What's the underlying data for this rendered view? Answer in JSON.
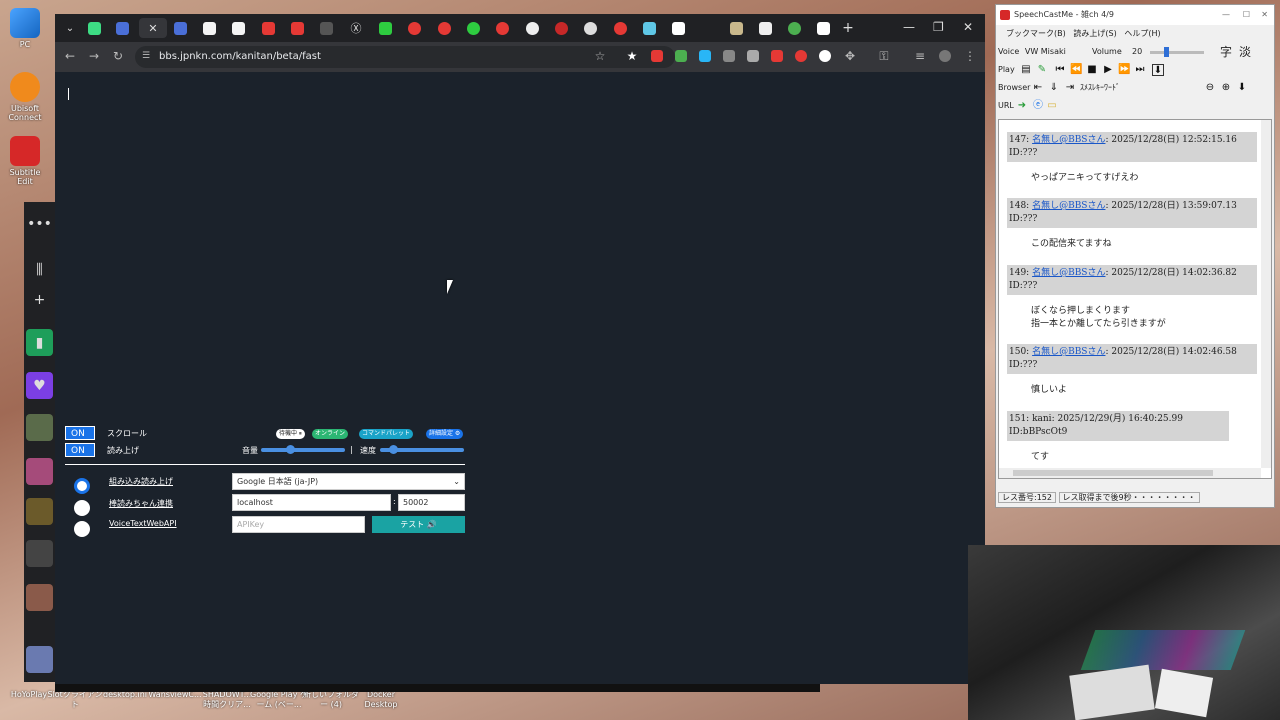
{
  "desktop_icons": [
    "PC",
    "Ubisoft Connect",
    "Subtitle Edit"
  ],
  "taskbar_icons": [
    "HoYoPlay",
    "Slotクライアント",
    "desktop.ini",
    "WansviewC...",
    "SHADOWT... 時間クリア...",
    "Google Play ゲーム (ベー...",
    "新しいフォルダー (4)",
    "Docker Desktop"
  ],
  "browser": {
    "url": "bbs.jpnkn.com/kanitan/beta/fast"
  },
  "panel": {
    "scroll_toggle": "ON",
    "scroll_label": "スクロール",
    "read_toggle": "ON",
    "read_label": "読み上げ",
    "badges": [
      "待機中 ⏸",
      "オンライン",
      "コマンドパレット",
      "詳細設定 ⚙"
    ],
    "volume_label": "音量",
    "speed_label": "速度",
    "volume_value": 0.35,
    "speed_value": 0.15,
    "tts_options": [
      "組み込み読み上げ",
      "棒読みちゃん連携",
      "VoiceTextWebAPI"
    ],
    "voice_select": "Google 日本語 (ja-JP)",
    "host": "localhost",
    "port": "50002",
    "apikey_placeholder": "APIKey",
    "test_button": "テスト 🔊"
  },
  "speechcast": {
    "title": "SpeechCastMe - 雑ch 4/9",
    "menu": [
      "ブックマーク(B)",
      "読み上げ(S)",
      "ヘルプ(H)"
    ],
    "voice_label": "Voice",
    "voice_name": "VW Misaki",
    "volume_label": "Volume",
    "volume_value": "20",
    "font_buttons": [
      "字",
      "淡"
    ],
    "play_label": "Play",
    "browser_label": "Browser",
    "keyword_label": "ｽﾒｽﾚｷｰﾜｰﾄﾞ",
    "url_label": "URL",
    "posts": [
      {
        "head": "147: ",
        "name": "名無し@BBSさん",
        "meta": ": 2025/12/28(日) 12:52:15.16 ID:???",
        "body": "やっぱアニキってすげえわ"
      },
      {
        "head": "148: ",
        "name": "名無し@BBSさん",
        "meta": ": 2025/12/28(日) 13:59:07.13 ID:???",
        "body": "この配信来てますね"
      },
      {
        "head": "149: ",
        "name": "名無し@BBSさん",
        "meta": ": 2025/12/28(日) 14:02:36.82 ID:???",
        "body": "ぼくなら押しまくります\n指一本とか離してたら引きますが"
      },
      {
        "head": "150: ",
        "name": "名無し@BBSさん",
        "meta": ": 2025/12/28(日) 14:02:46.58 ID:???",
        "body": "慎しいよ"
      },
      {
        "head": "151: kani",
        "name": "",
        "meta": ": 2025/12/29(月) 16:40:25.99 ID:bBPscOt9",
        "body": "てす"
      }
    ],
    "status": [
      "レス番号:152",
      "レス取得まで後9秒・・・・・・・・"
    ]
  }
}
